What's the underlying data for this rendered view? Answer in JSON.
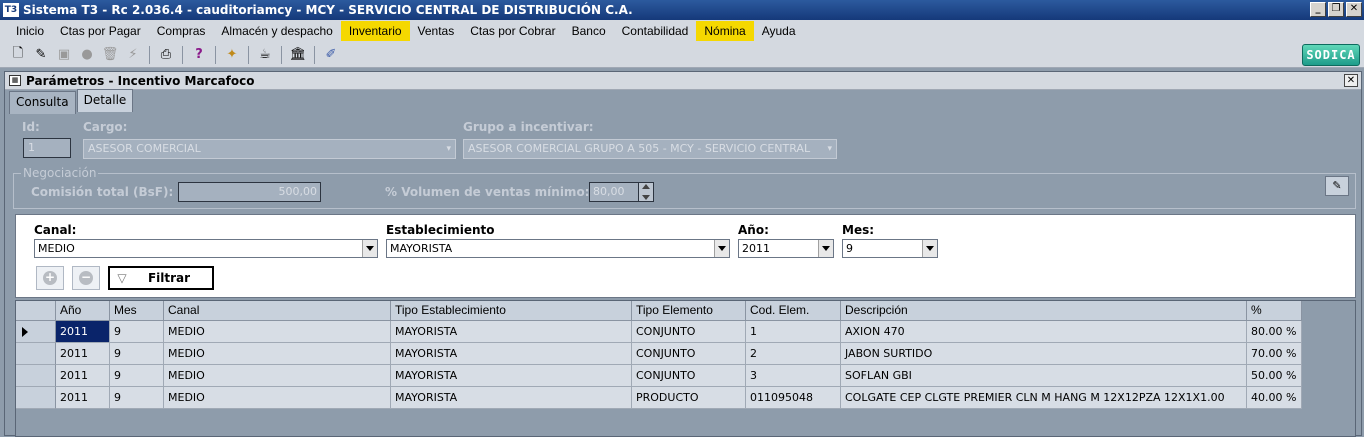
{
  "app": {
    "title": "Sistema T3 - Rc 2.036.4 - cauditoriamcy - MCY - SERVICIO CENTRAL DE DISTRIBUCIÓN C.A.",
    "logo": "SODICA"
  },
  "menu": [
    {
      "label": "Inicio",
      "highlight": false
    },
    {
      "label": "Ctas por Pagar",
      "highlight": false
    },
    {
      "label": "Compras",
      "highlight": false
    },
    {
      "label": "Almacén y despacho",
      "highlight": false
    },
    {
      "label": "Inventario",
      "highlight": true
    },
    {
      "label": "Ventas",
      "highlight": false
    },
    {
      "label": "Ctas por Cobrar",
      "highlight": false
    },
    {
      "label": "Banco",
      "highlight": false
    },
    {
      "label": "Contabilidad",
      "highlight": false
    },
    {
      "label": "Nómina",
      "highlight": true
    },
    {
      "label": "Ayuda",
      "highlight": false
    }
  ],
  "window": {
    "title": "Parámetros - Incentivo Marcafoco"
  },
  "tabs": [
    {
      "label": "Consulta",
      "active": false
    },
    {
      "label": "Detalle",
      "active": true
    }
  ],
  "form": {
    "id_label": "Id:",
    "id_value": "1",
    "cargo_label": "Cargo:",
    "cargo_value": "ASESOR COMERCIAL",
    "grupo_label": "Grupo a incentivar:",
    "grupo_value": "ASESOR COMERCIAL GRUPO A 505 - MCY - SERVICIO CENTRAL",
    "negociacion_label": "Negociación",
    "comision_label": "Comisión total (BsF):",
    "comision_value": "500,00",
    "volumen_label": "% Volumen de ventas mínimo:",
    "volumen_value": "80,00"
  },
  "filter": {
    "canal_label": "Canal:",
    "canal_value": "MEDIO",
    "estab_label": "Establecimiento",
    "estab_value": "MAYORISTA",
    "anio_label": "Año:",
    "anio_value": "2011",
    "mes_label": "Mes:",
    "mes_value": "9",
    "filtrar_label": "Filtrar"
  },
  "grid": {
    "columns": [
      "Año",
      "Mes",
      "Canal",
      "Tipo Establecimiento",
      "Tipo Elemento",
      "Cod. Elem.",
      "Descripción",
      "%"
    ],
    "rows": [
      [
        "2011",
        "9",
        "MEDIO",
        "MAYORISTA",
        "CONJUNTO",
        "1",
        "AXION 470",
        "80.00 %"
      ],
      [
        "2011",
        "9",
        "MEDIO",
        "MAYORISTA",
        "CONJUNTO",
        "2",
        "JABON SURTIDO",
        "70.00 %"
      ],
      [
        "2011",
        "9",
        "MEDIO",
        "MAYORISTA",
        "CONJUNTO",
        "3",
        "SOFLAN GBI",
        "50.00 %"
      ],
      [
        "2011",
        "9",
        "MEDIO",
        "MAYORISTA",
        "PRODUCTO",
        "011095048",
        "COLGATE CEP CLGTE PREMIER CLN M HANG M 12X12PZA 12X1X1.00",
        "40.00 %"
      ]
    ]
  }
}
